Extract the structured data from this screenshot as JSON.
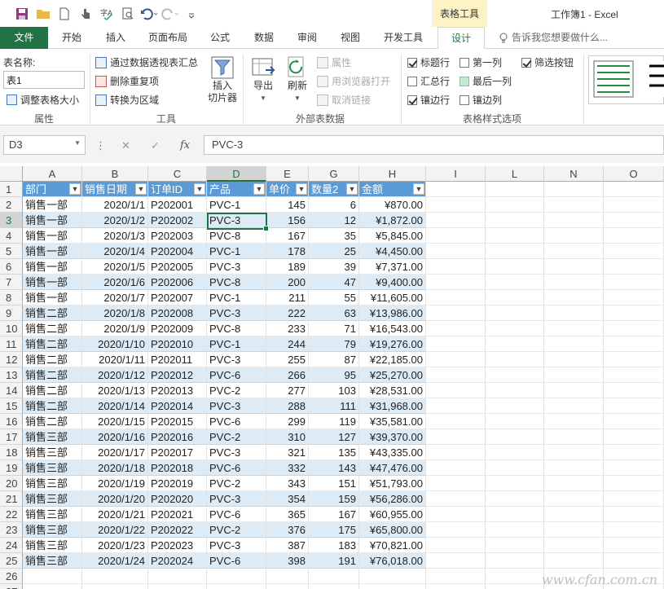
{
  "titlebar": {
    "context_label": "表格工具",
    "window_title": "工作簿1 - Excel"
  },
  "tabs": [
    {
      "label": "文件"
    },
    {
      "label": "开始"
    },
    {
      "label": "插入"
    },
    {
      "label": "页面布局"
    },
    {
      "label": "公式"
    },
    {
      "label": "数据"
    },
    {
      "label": "审阅"
    },
    {
      "label": "视图"
    },
    {
      "label": "开发工具"
    },
    {
      "label": "设计"
    }
  ],
  "tell_me": "告诉我您想要做什么...",
  "ribbon": {
    "props": {
      "table_name_label": "表名称:",
      "table_name_value": "表1",
      "resize_table": "调整表格大小",
      "group": "属性"
    },
    "tools": {
      "summarize_pivot": "通过数据透视表汇总",
      "remove_duplicates": "删除重复项",
      "convert_range": "转换为区域",
      "insert_slicer_1": "插入",
      "insert_slicer_2": "切片器",
      "group": "工具"
    },
    "external": {
      "export": "导出",
      "refresh": "刷新",
      "properties": "属性",
      "open_browser": "用浏览器打开",
      "unlink": "取消链接",
      "group": "外部表数据"
    },
    "style_options": {
      "header_row": "标题行",
      "first_column": "第一列",
      "filter_button": "筛选按钮",
      "total_row": "汇总行",
      "last_column": "最后一列",
      "banded_rows": "镶边行",
      "banded_columns": "镶边列",
      "group": "表格样式选项"
    }
  },
  "formula_bar": {
    "name_box": "D3",
    "fx": "fx",
    "content": "PVC-3"
  },
  "columns": [
    "A",
    "B",
    "C",
    "D",
    "E",
    "G",
    "H",
    "I",
    "L",
    "N",
    "O"
  ],
  "table_headers": [
    "部门",
    "销售日期",
    "订单ID",
    "产品",
    "单价",
    "数量2",
    "金额"
  ],
  "rows": [
    [
      "销售一部",
      "2020/1/1",
      "P202001",
      "PVC-1",
      "145",
      "6",
      "¥870.00"
    ],
    [
      "销售一部",
      "2020/1/2",
      "P202002",
      "PVC-3",
      "156",
      "12",
      "¥1,872.00"
    ],
    [
      "销售一部",
      "2020/1/3",
      "P202003",
      "PVC-8",
      "167",
      "35",
      "¥5,845.00"
    ],
    [
      "销售一部",
      "2020/1/4",
      "P202004",
      "PVC-1",
      "178",
      "25",
      "¥4,450.00"
    ],
    [
      "销售一部",
      "2020/1/5",
      "P202005",
      "PVC-3",
      "189",
      "39",
      "¥7,371.00"
    ],
    [
      "销售一部",
      "2020/1/6",
      "P202006",
      "PVC-8",
      "200",
      "47",
      "¥9,400.00"
    ],
    [
      "销售一部",
      "2020/1/7",
      "P202007",
      "PVC-1",
      "211",
      "55",
      "¥11,605.00"
    ],
    [
      "销售二部",
      "2020/1/8",
      "P202008",
      "PVC-3",
      "222",
      "63",
      "¥13,986.00"
    ],
    [
      "销售二部",
      "2020/1/9",
      "P202009",
      "PVC-8",
      "233",
      "71",
      "¥16,543.00"
    ],
    [
      "销售二部",
      "2020/1/10",
      "P202010",
      "PVC-1",
      "244",
      "79",
      "¥19,276.00"
    ],
    [
      "销售二部",
      "2020/1/11",
      "P202011",
      "PVC-3",
      "255",
      "87",
      "¥22,185.00"
    ],
    [
      "销售二部",
      "2020/1/12",
      "P202012",
      "PVC-6",
      "266",
      "95",
      "¥25,270.00"
    ],
    [
      "销售二部",
      "2020/1/13",
      "P202013",
      "PVC-2",
      "277",
      "103",
      "¥28,531.00"
    ],
    [
      "销售二部",
      "2020/1/14",
      "P202014",
      "PVC-3",
      "288",
      "111",
      "¥31,968.00"
    ],
    [
      "销售二部",
      "2020/1/15",
      "P202015",
      "PVC-6",
      "299",
      "119",
      "¥35,581.00"
    ],
    [
      "销售三部",
      "2020/1/16",
      "P202016",
      "PVC-2",
      "310",
      "127",
      "¥39,370.00"
    ],
    [
      "销售三部",
      "2020/1/17",
      "P202017",
      "PVC-3",
      "321",
      "135",
      "¥43,335.00"
    ],
    [
      "销售三部",
      "2020/1/18",
      "P202018",
      "PVC-6",
      "332",
      "143",
      "¥47,476.00"
    ],
    [
      "销售三部",
      "2020/1/19",
      "P202019",
      "PVC-2",
      "343",
      "151",
      "¥51,793.00"
    ],
    [
      "销售三部",
      "2020/1/20",
      "P202020",
      "PVC-3",
      "354",
      "159",
      "¥56,286.00"
    ],
    [
      "销售三部",
      "2020/1/21",
      "P202021",
      "PVC-6",
      "365",
      "167",
      "¥60,955.00"
    ],
    [
      "销售三部",
      "2020/1/22",
      "P202022",
      "PVC-2",
      "376",
      "175",
      "¥65,800.00"
    ],
    [
      "销售三部",
      "2020/1/23",
      "P202023",
      "PVC-3",
      "387",
      "183",
      "¥70,821.00"
    ],
    [
      "销售三部",
      "2020/1/24",
      "P202024",
      "PVC-6",
      "398",
      "191",
      "¥76,018.00"
    ]
  ],
  "row_numbers": [
    "1",
    "2",
    "3",
    "4",
    "5",
    "6",
    "7",
    "8",
    "9",
    "10",
    "11",
    "12",
    "13",
    "14",
    "15",
    "16",
    "17",
    "18",
    "19",
    "20",
    "21",
    "22",
    "23",
    "24",
    "25",
    "26",
    "27"
  ],
  "watermark": "www.cfan.com.cn",
  "colors": {
    "excel_green": "#217346",
    "table_header": "#5b9bd5",
    "band": "#ddebf7",
    "context_tab": "#fdf3c4"
  }
}
